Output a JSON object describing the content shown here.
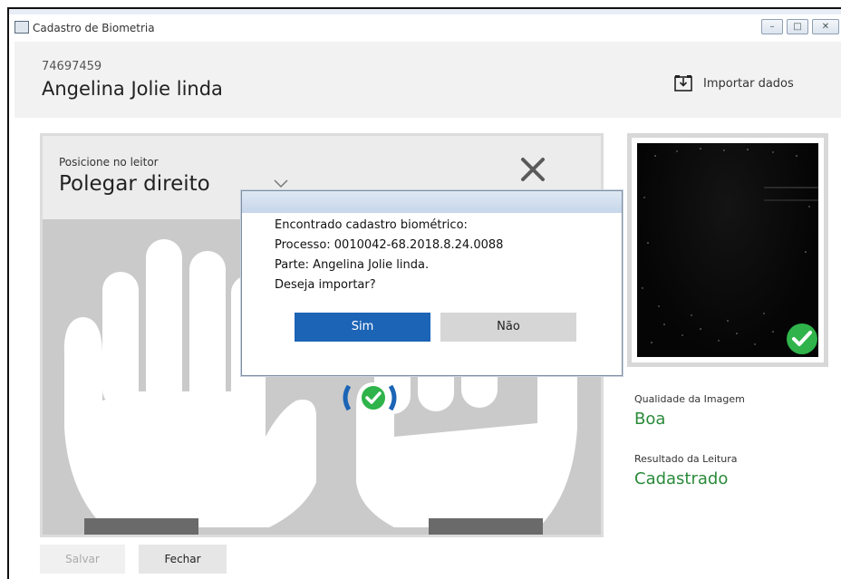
{
  "window": {
    "title": "Cadastro de Biometria",
    "controls": {
      "minimize": "–",
      "maximize": "□",
      "close": "✕"
    }
  },
  "header": {
    "user_id": "74697459",
    "user_name": "Angelina Jolie linda",
    "import_label": "Importar dados"
  },
  "prompt": {
    "label": "Posicione no leitor",
    "finger": "Polegar direito"
  },
  "result": {
    "quality_label": "Qualidade da Imagem",
    "quality_value": "Boa",
    "read_label": "Resultado da Leitura",
    "read_value": "Cadastrado"
  },
  "footer": {
    "save_label": "Salvar",
    "close_label": "Fechar"
  },
  "dialog": {
    "lines": [
      "Encontrado cadastro biométrico:",
      "Processo: 0010042-68.2018.8.24.0088",
      "Parte: Angelina Jolie linda.",
      "Deseja importar?"
    ],
    "yes_label": "Sim",
    "no_label": "Não"
  },
  "colors": {
    "accent_blue": "#1c64b6",
    "success_green": "#2a8a3a",
    "check_green": "#2fb34a"
  },
  "icons": {
    "title": "app-window-icon",
    "import": "import-tray-icon",
    "close": "close-x-icon",
    "dropdown": "chevron-down-icon",
    "scanner": "fingerprint-scan-icon",
    "ok": "check-circle-icon"
  }
}
